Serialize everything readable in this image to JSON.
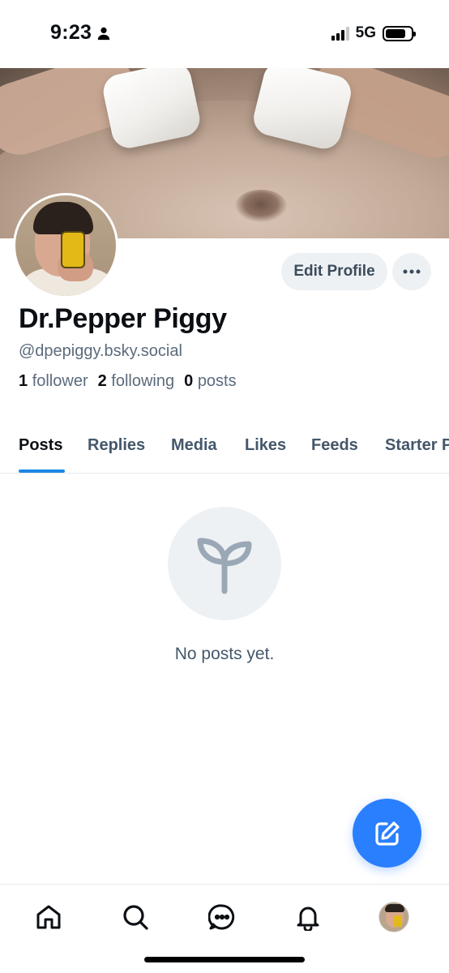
{
  "status_bar": {
    "time": "9:23",
    "network": "5G"
  },
  "profile": {
    "display_name": "Dr.Pepper Piggy",
    "handle": "@dpepiggy.bsky.social",
    "followers_count": "1",
    "followers_label": "follower",
    "following_count": "2",
    "following_label": "following",
    "posts_count": "0",
    "posts_label": "posts",
    "edit_label": "Edit Profile"
  },
  "tabs": [
    {
      "label": "Posts",
      "active": true
    },
    {
      "label": "Replies"
    },
    {
      "label": "Media"
    },
    {
      "label": "Likes"
    },
    {
      "label": "Feeds"
    },
    {
      "label": "Starter Packs"
    }
  ],
  "empty_state": {
    "message": "No posts yet.",
    "icon": "sprout-icon"
  },
  "fab": {
    "icon": "compose-icon"
  },
  "bottom_nav": [
    {
      "icon": "home-icon"
    },
    {
      "icon": "search-icon"
    },
    {
      "icon": "chat-icon"
    },
    {
      "icon": "bell-icon"
    },
    {
      "icon": "profile-avatar"
    }
  ],
  "colors": {
    "accent": "#2a7fff",
    "tab_indicator": "#1e88e5",
    "muted_text": "#5b6b7c"
  }
}
